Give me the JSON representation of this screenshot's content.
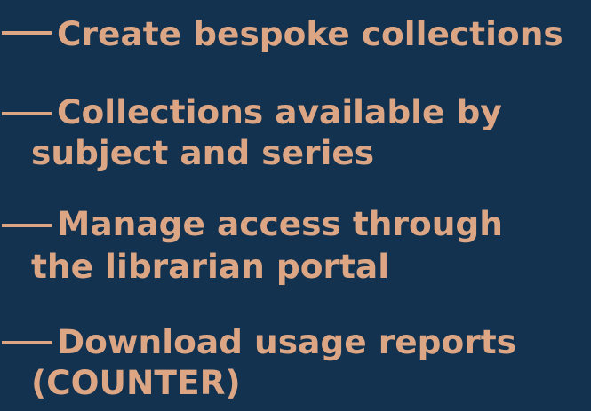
{
  "features": {
    "items": [
      {
        "lines": [
          "Create bespoke collections"
        ]
      },
      {
        "lines": [
          "Collections available by",
          "subject and series"
        ]
      },
      {
        "lines": [
          "Manage access through",
          "the librarian portal"
        ]
      },
      {
        "lines": [
          "Download usage reports",
          "(COUNTER)"
        ]
      }
    ]
  }
}
